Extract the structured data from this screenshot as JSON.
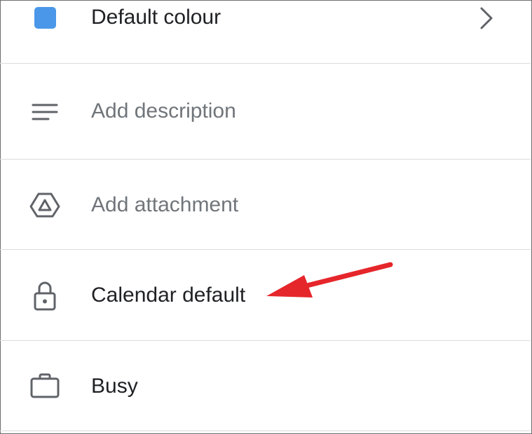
{
  "rows": [
    {
      "label": "Default colour",
      "icon": "color-swatch-icon",
      "has_chevron": true
    },
    {
      "label": "Add description",
      "icon": "notes-lines-icon",
      "placeholder": true
    },
    {
      "label": "Add attachment",
      "icon": "google-drive-icon",
      "placeholder": true
    },
    {
      "label": "Calendar default",
      "icon": "lock-icon"
    },
    {
      "label": "Busy",
      "icon": "briefcase-icon"
    }
  ],
  "colors": {
    "swatch": "#4a97e9",
    "icon": "#5f6368",
    "annotation_arrow": "#e5262b",
    "separator": "#dcdcdc"
  }
}
